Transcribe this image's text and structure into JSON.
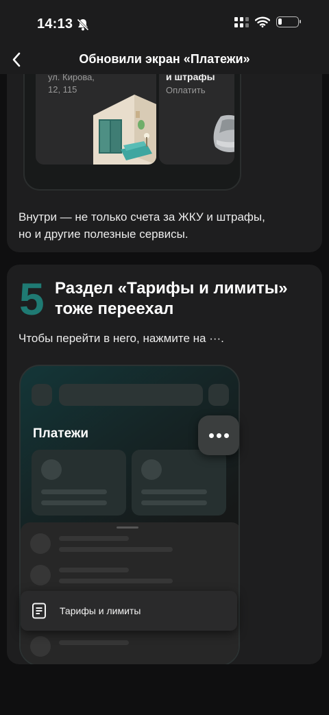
{
  "status_bar": {
    "time": "14:13",
    "icons": [
      "bell-slash-icon",
      "signal-icon",
      "wifi-icon",
      "battery-icon"
    ],
    "battery_level": 0.2
  },
  "nav": {
    "back_icon": "chevron-left-icon",
    "title": "Обновили экран «Платежи»"
  },
  "card1": {
    "address_line1": "ул. Кирова,",
    "address_line2": "12, 115",
    "fines_label": "и штрафы",
    "pay_label": "Оплатить",
    "text_line1": "Внутри  — не только счета за ЖКУ и штрафы,",
    "text_line2": "но и другие полезные сервисы."
  },
  "card2": {
    "step_number": "5",
    "title_line1": "Раздел «Тарифы и лимиты»",
    "title_line2": "тоже переехал",
    "description": "Чтобы перейти в него, нажмите на ···.",
    "accent_color": "#1f7a73",
    "phone": {
      "screen_title": "Платежи",
      "more_icon": "more-dots-icon",
      "highlight_label": "Тарифы и лимиты",
      "highlight_icon": "document-icon"
    }
  }
}
